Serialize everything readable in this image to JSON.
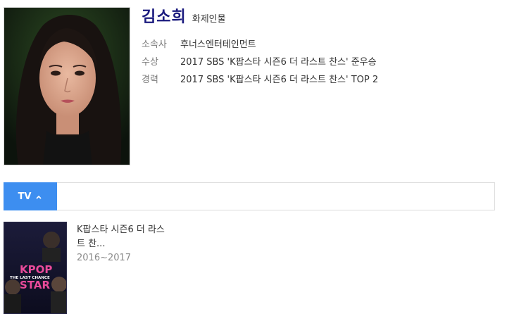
{
  "person": {
    "name": "김소희",
    "tag": "화제인물"
  },
  "info": [
    {
      "label": "소속사",
      "value": "후너스엔터테인먼트"
    },
    {
      "label": "수상",
      "value": "2017 SBS 'K팝스타 시즌6 더 라스트 찬스' 준우승"
    },
    {
      "label": "경력",
      "value": "2017 SBS 'K팝스타 시즌6 더 라스트 찬스' TOP 2"
    }
  ],
  "tabs": {
    "tv_label": "TV"
  },
  "shows": [
    {
      "title": "K팝스타 시즌6 더 라스트 찬...",
      "years": "2016~2017",
      "poster_text": [
        "KPOP",
        "THE LAST CHANCE",
        "STAR"
      ]
    }
  ],
  "colors": {
    "name": "#1a1a7e",
    "tab_active": "#3d8ef0"
  }
}
